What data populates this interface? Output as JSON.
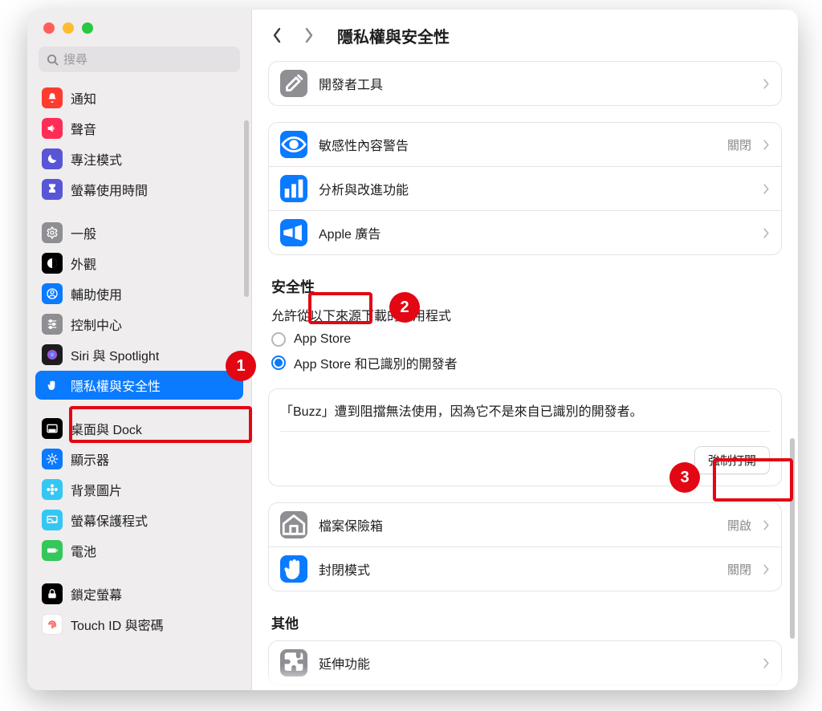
{
  "window": {
    "title": "隱私權與安全性",
    "search_placeholder": "搜尋"
  },
  "sidebar": {
    "groups": [
      [
        {
          "id": "notifications",
          "label": "通知",
          "bg": "#ff3b30",
          "glyph": "bell"
        },
        {
          "id": "sound",
          "label": "聲音",
          "bg": "#ff2d55",
          "glyph": "speaker"
        },
        {
          "id": "focus",
          "label": "專注模式",
          "bg": "#5856d6",
          "glyph": "moon"
        },
        {
          "id": "screentime",
          "label": "螢幕使用時間",
          "bg": "#5856d6",
          "glyph": "hourglass"
        }
      ],
      [
        {
          "id": "general",
          "label": "一般",
          "bg": "#8e8e93",
          "glyph": "gear"
        },
        {
          "id": "appearance",
          "label": "外觀",
          "bg": "#000000",
          "glyph": "contrast"
        },
        {
          "id": "accessibility",
          "label": "輔助使用",
          "bg": "#0a7aff",
          "glyph": "person"
        },
        {
          "id": "controlcenter",
          "label": "控制中心",
          "bg": "#8e8e93",
          "glyph": "sliders"
        },
        {
          "id": "siri",
          "label": "Siri 與 Spotlight",
          "bg": "#1d1d1f",
          "glyph": "siri"
        },
        {
          "id": "privacy",
          "label": "隱私權與安全性",
          "bg": "#0a7aff",
          "glyph": "hand",
          "selected": true
        }
      ],
      [
        {
          "id": "desktop",
          "label": "桌面與 Dock",
          "bg": "#000000",
          "glyph": "dock"
        },
        {
          "id": "displays",
          "label": "顯示器",
          "bg": "#0a7aff",
          "glyph": "sun"
        },
        {
          "id": "wallpaper",
          "label": "背景圖片",
          "bg": "#34c7f4",
          "glyph": "flower"
        },
        {
          "id": "screensaver",
          "label": "螢幕保護程式",
          "bg": "#34c7f4",
          "glyph": "screensaver"
        },
        {
          "id": "battery",
          "label": "電池",
          "bg": "#34c759",
          "glyph": "battery"
        }
      ],
      [
        {
          "id": "lockscreen",
          "label": "鎖定螢幕",
          "bg": "#000000",
          "glyph": "lock"
        },
        {
          "id": "touchid",
          "label": "Touch ID 與密碼",
          "bg": "#ffffff",
          "border": "#e5e3e6",
          "glyph": "fingerprint",
          "fg": "#ff3b30"
        }
      ]
    ]
  },
  "content": {
    "rows_top": [
      {
        "id": "devtools",
        "label": "開發者工具",
        "bg": "#8e8e93",
        "glyph": "tools",
        "value": ""
      },
      {
        "id": "sensitive",
        "label": "敏感性內容警告",
        "bg": "#0a7aff",
        "glyph": "eye",
        "value": "關閉"
      },
      {
        "id": "analytics",
        "label": "分析與改進功能",
        "bg": "#0a7aff",
        "glyph": "bars",
        "value": ""
      },
      {
        "id": "appleads",
        "label": "Apple 廣告",
        "bg": "#0a7aff",
        "glyph": "megaphone",
        "value": ""
      }
    ],
    "security": {
      "title": "安全性",
      "allow_label": "允許從以下來源下載的應用程式",
      "options": [
        {
          "id": "appstore",
          "label": "App Store",
          "checked": false
        },
        {
          "id": "identified",
          "label": "App Store 和已識別的開發者",
          "checked": true
        }
      ],
      "blocked_msg": "「Buzz」遭到阻擋無法使用，因為它不是來自已識別的開發者。",
      "open_anyway": "強制打開"
    },
    "rows_mid": [
      {
        "id": "filevault",
        "label": "檔案保險箱",
        "bg": "#8e8e93",
        "glyph": "house",
        "value": "開啟"
      },
      {
        "id": "lockdown",
        "label": "封閉模式",
        "bg": "#0a7aff",
        "glyph": "hand",
        "value": "關閉"
      }
    ],
    "other_title": "其他",
    "rows_bottom": [
      {
        "id": "extensions",
        "label": "延伸功能",
        "bg": "#8e8e93",
        "glyph": "puzzle",
        "value": ""
      }
    ]
  },
  "annotations": {
    "b1": "1",
    "b2": "2",
    "b3": "3"
  }
}
